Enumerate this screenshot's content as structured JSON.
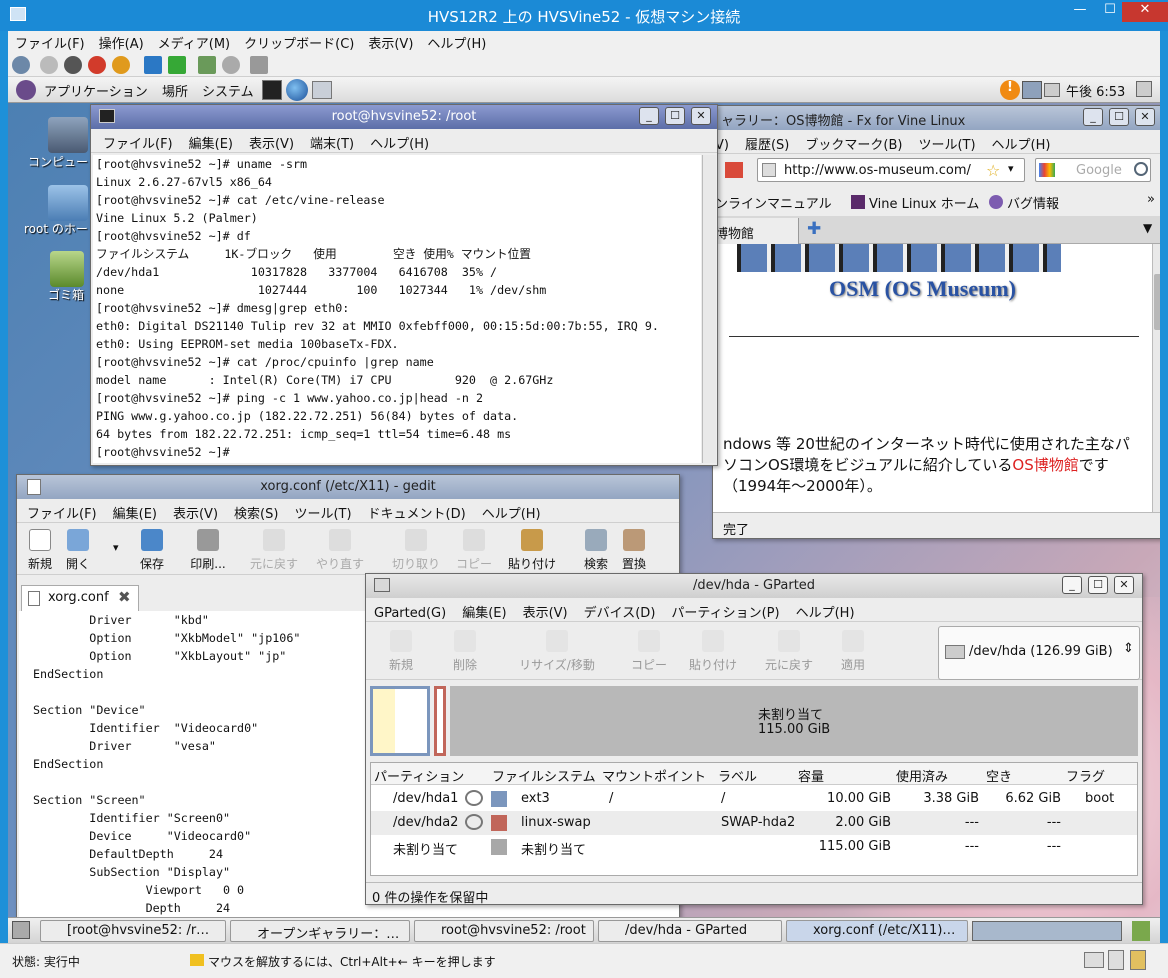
{
  "host": {
    "title": "HVS12R2 上の HVSVine52 - 仮想マシン接続",
    "menu": [
      "ファイル(F)",
      "操作(A)",
      "メディア(M)",
      "クリップボード(C)",
      "表示(V)",
      "ヘルプ(H)"
    ],
    "status_label": "状態: 実行中",
    "status_hint": "マウスを解放するには、Ctrl+Alt+← キーを押します"
  },
  "panel": {
    "apps": "アプリケーション",
    "places": "場所",
    "system": "システム",
    "clock": "午後 6:53"
  },
  "desktop": {
    "computer": "コンピュー",
    "home": "root のホー",
    "trash": "ゴミ箱"
  },
  "terminal": {
    "title": "root@hvsvine52: /root",
    "menu": [
      "ファイル(F)",
      "編集(E)",
      "表示(V)",
      "端末(T)",
      "ヘルプ(H)"
    ],
    "lines": [
      "[root@hvsvine52 ~]# uname -srm",
      "Linux 2.6.27-67vl5 x86_64",
      "[root@hvsvine52 ~]# cat /etc/vine-release",
      "Vine Linux 5.2 (Palmer)",
      "[root@hvsvine52 ~]# df",
      "ファイルシステム     1K-ブロック   使用        空き 使用% マウント位置",
      "/dev/hda1             10317828   3377004   6416708  35% /",
      "none                   1027444       100   1027344   1% /dev/shm",
      "[root@hvsvine52 ~]# dmesg|grep eth0:",
      "eth0: Digital DS21140 Tulip rev 32 at MMIO 0xfebff000, 00:15:5d:00:7b:55, IRQ 9.",
      "eth0: Using EEPROM-set media 100baseTx-FDX.",
      "[root@hvsvine52 ~]# cat /proc/cpuinfo |grep name",
      "model name      : Intel(R) Core(TM) i7 CPU         920  @ 2.67GHz",
      "[root@hvsvine52 ~]# ping -c 1 www.yahoo.co.jp|head -n 2",
      "PING www.g.yahoo.co.jp (182.22.72.251) 56(84) bytes of data.",
      "64 bytes from 182.22.72.251: icmp_seq=1 ttl=54 time=6.48 ms",
      "[root@hvsvine52 ~]#"
    ]
  },
  "browser": {
    "title": "ャラリー：OS博物館 - Fx for Vine Linux",
    "menu": [
      "V)",
      "履歴(S)",
      "ブックマーク(B)",
      "ツール(T)",
      "ヘルプ(H)"
    ],
    "url": "http://www.os-museum.com/",
    "search_placeholder": "Google",
    "bookmarks": [
      "ンラインマニュアル",
      "Vine Linux ホーム",
      "バグ情報"
    ],
    "tab": "博物館",
    "banner": "OSM (OS Museum)",
    "text_before": "ndows 等 20世紀のインターネット時代に使用された主なパソコンOS環境をビジュアルに紹介している",
    "text_link": "OS博物館",
    "text_after": "です（1994年〜2000年）。",
    "status": "完了"
  },
  "gedit": {
    "title": "xorg.conf (/etc/X11) - gedit",
    "menu": [
      "ファイル(F)",
      "編集(E)",
      "表示(V)",
      "検索(S)",
      "ツール(T)",
      "ドキュメント(D)",
      "ヘルプ(H)"
    ],
    "tools": [
      "新規",
      "開く",
      "保存",
      "印刷...",
      "元に戻す",
      "やり直す",
      "切り取り",
      "コピー",
      "貼り付け",
      "検索",
      "置換"
    ],
    "tab": "xorg.conf",
    "lines": [
      "        Driver      \"kbd\"",
      "        Option      \"XkbModel\" \"jp106\"",
      "        Option      \"XkbLayout\" \"jp\"",
      "EndSection",
      "",
      "Section \"Device\"",
      "        Identifier  \"Videocard0\"",
      "        Driver      \"vesa\"",
      "EndSection",
      "",
      "Section \"Screen\"",
      "        Identifier \"Screen0\"",
      "        Device     \"Videocard0\"",
      "        DefaultDepth     24",
      "        SubSection \"Display\"",
      "                Viewport   0 0",
      "                Depth     24"
    ]
  },
  "gparted": {
    "title": "/dev/hda - GParted",
    "menu": [
      "GParted(G)",
      "編集(E)",
      "表示(V)",
      "デバイス(D)",
      "パーティション(P)",
      "ヘルプ(H)"
    ],
    "tools": [
      "新規",
      "削除",
      "リサイズ/移動",
      "コピー",
      "貼り付け",
      "元に戻す",
      "適用"
    ],
    "device": "/dev/hda  (126.99 GiB)",
    "unalloc_label": "未割り当て",
    "unalloc_size": "115.00 GiB",
    "columns": [
      "パーティション",
      "ファイルシステム",
      "マウントポイント",
      "ラベル",
      "容量",
      "使用済み",
      "空き",
      "フラグ"
    ],
    "rows": [
      {
        "part": "/dev/hda1",
        "fs": "ext3",
        "mount": "/",
        "label": "/",
        "size": "10.00 GiB",
        "used": "3.38 GiB",
        "free": "6.62 GiB",
        "flag": "boot",
        "color": "#7b96bd"
      },
      {
        "part": "/dev/hda2",
        "fs": "linux-swap",
        "mount": "",
        "label": "SWAP-hda2",
        "size": "2.00 GiB",
        "used": "---",
        "free": "---",
        "flag": "",
        "color": "#c1665a"
      },
      {
        "part": "未割り当て",
        "fs": "未割り当て",
        "mount": "",
        "label": "",
        "size": "115.00 GiB",
        "used": "---",
        "free": "---",
        "flag": "",
        "color": "#a8a8a8"
      }
    ],
    "status": "0 件の操作を保留中"
  },
  "taskbar": [
    "[root@hvsvine52: /r…",
    "オープンギャラリー：…",
    "root@hvsvine52: /root",
    "/dev/hda - GParted",
    "xorg.conf (/etc/X11)…"
  ]
}
